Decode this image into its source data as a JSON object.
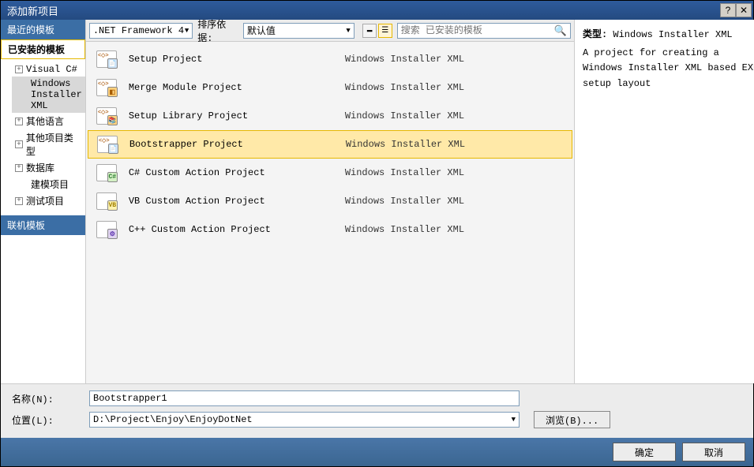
{
  "title": "添加新项目",
  "sidebar": {
    "recent_header": "最近的模板",
    "installed_header": "已安装的模板",
    "online_header": "联机模板",
    "items": [
      {
        "label": "Visual C#",
        "expandable": true
      },
      {
        "label": "Windows Installer XML",
        "expandable": false,
        "selected": true
      },
      {
        "label": "其他语言",
        "expandable": true
      },
      {
        "label": "其他项目类型",
        "expandable": true
      },
      {
        "label": "数据库",
        "expandable": true
      },
      {
        "label": "建模项目",
        "expandable": false
      },
      {
        "label": "测试项目",
        "expandable": true
      }
    ]
  },
  "toolbar": {
    "framework": ".NET Framework 4",
    "sort_label": "排序依据:",
    "sort_value": "默认值",
    "search_placeholder": "搜索 已安装的模板"
  },
  "templates": [
    {
      "name": "Setup Project",
      "category": "Windows Installer XML",
      "badge": "blue"
    },
    {
      "name": "Merge Module Project",
      "category": "Windows Installer XML",
      "badge": "orange"
    },
    {
      "name": "Setup Library Project",
      "category": "Windows Installer XML",
      "badge": "orange2"
    },
    {
      "name": "Bootstrapper Project",
      "category": "Windows Installer XML",
      "badge": "blue",
      "selected": true
    },
    {
      "name": "C# Custom Action Project",
      "category": "Windows Installer XML",
      "badge": "greenC"
    },
    {
      "name": "VB Custom Action Project",
      "category": "Windows Installer XML",
      "badge": "yellowV"
    },
    {
      "name": "C++ Custom Action Project",
      "category": "Windows Installer XML",
      "badge": "cpp"
    }
  ],
  "details": {
    "type_label": "类型:",
    "type_value": "Windows Installer XML",
    "description": "A project for creating a Windows Installer XML based EXE setup layout"
  },
  "form": {
    "name_label": "名称(N):",
    "name_value": "Bootstrapper1",
    "location_label": "位置(L):",
    "location_value": "D:\\Project\\Enjoy\\EnjoyDotNet",
    "browse": "浏览(B)..."
  },
  "footer": {
    "ok": "确定",
    "cancel": "取消"
  },
  "titlebar_help": "?",
  "titlebar_close": "✕"
}
